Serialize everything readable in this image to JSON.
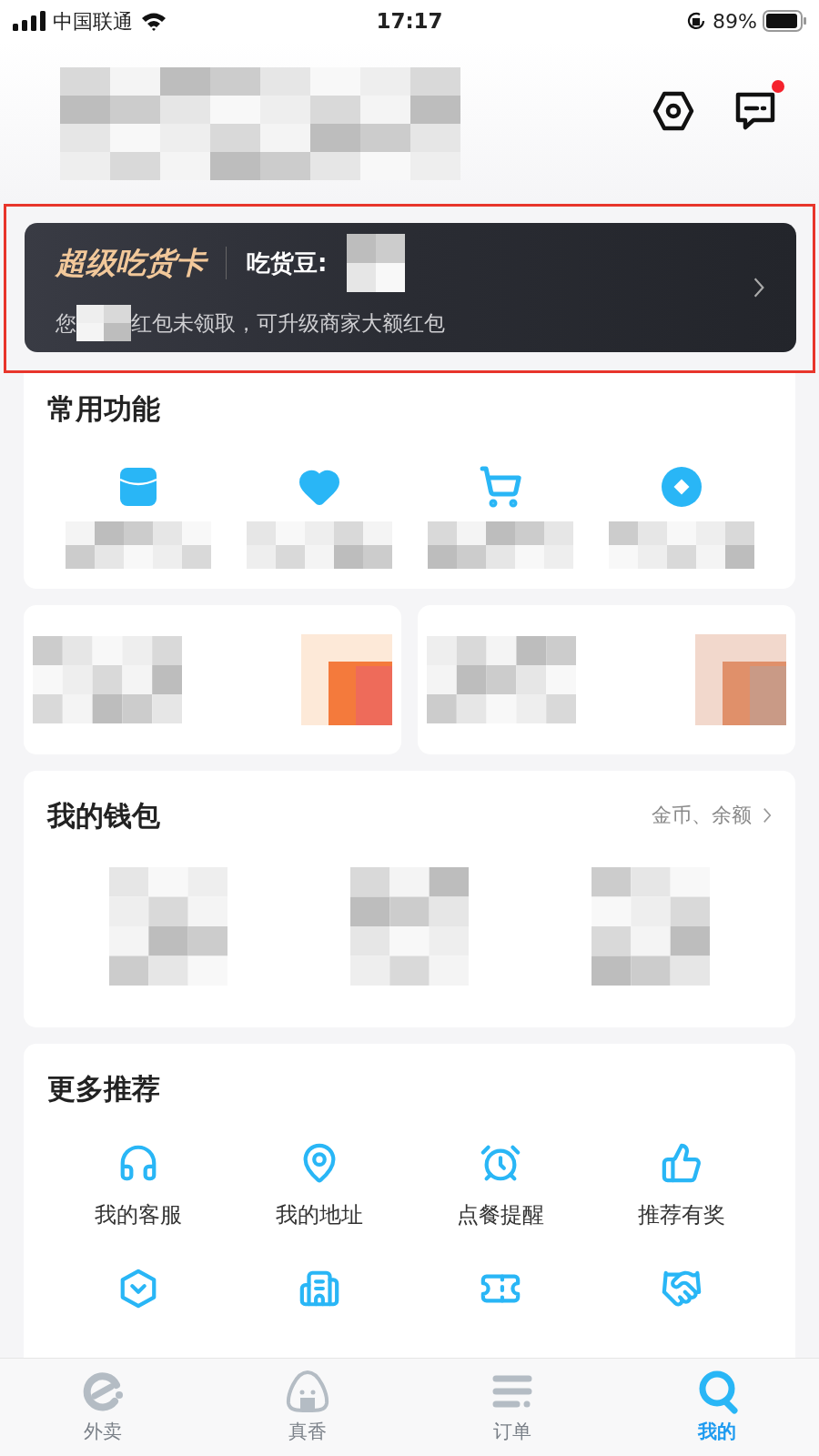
{
  "status_bar": {
    "carrier": "中国联通",
    "time": "17:17",
    "battery": "89%"
  },
  "header": {
    "messages_badge": true
  },
  "super_card": {
    "title": "超级吃货卡",
    "beans_label": "吃货豆:",
    "note_prefix": "您",
    "note_rest": "红包未领取，可升级商家大额红包",
    "highlighted": true
  },
  "common": {
    "title": "常用功能",
    "items": [
      {
        "kind": "packet"
      },
      {
        "kind": "heart"
      },
      {
        "kind": "cart"
      },
      {
        "kind": "coin"
      }
    ]
  },
  "wallet": {
    "title": "我的钱包",
    "link": "金币、余额"
  },
  "more": {
    "title": "更多推荐",
    "items": [
      {
        "kind": "headset",
        "label": "我的客服"
      },
      {
        "kind": "pin",
        "label": "我的地址"
      },
      {
        "kind": "alarm",
        "label": "点餐提醒"
      },
      {
        "kind": "thumb",
        "label": "推荐有奖"
      },
      {
        "kind": "vip"
      },
      {
        "kind": "building"
      },
      {
        "kind": "ticket"
      },
      {
        "kind": "handshake"
      }
    ]
  },
  "tabs": [
    {
      "label": "外卖",
      "kind": "e",
      "selected": false
    },
    {
      "label": "真香",
      "kind": "rice",
      "selected": false
    },
    {
      "label": "订单",
      "kind": "list",
      "selected": false
    },
    {
      "label": "我的",
      "kind": "me",
      "selected": true
    }
  ]
}
